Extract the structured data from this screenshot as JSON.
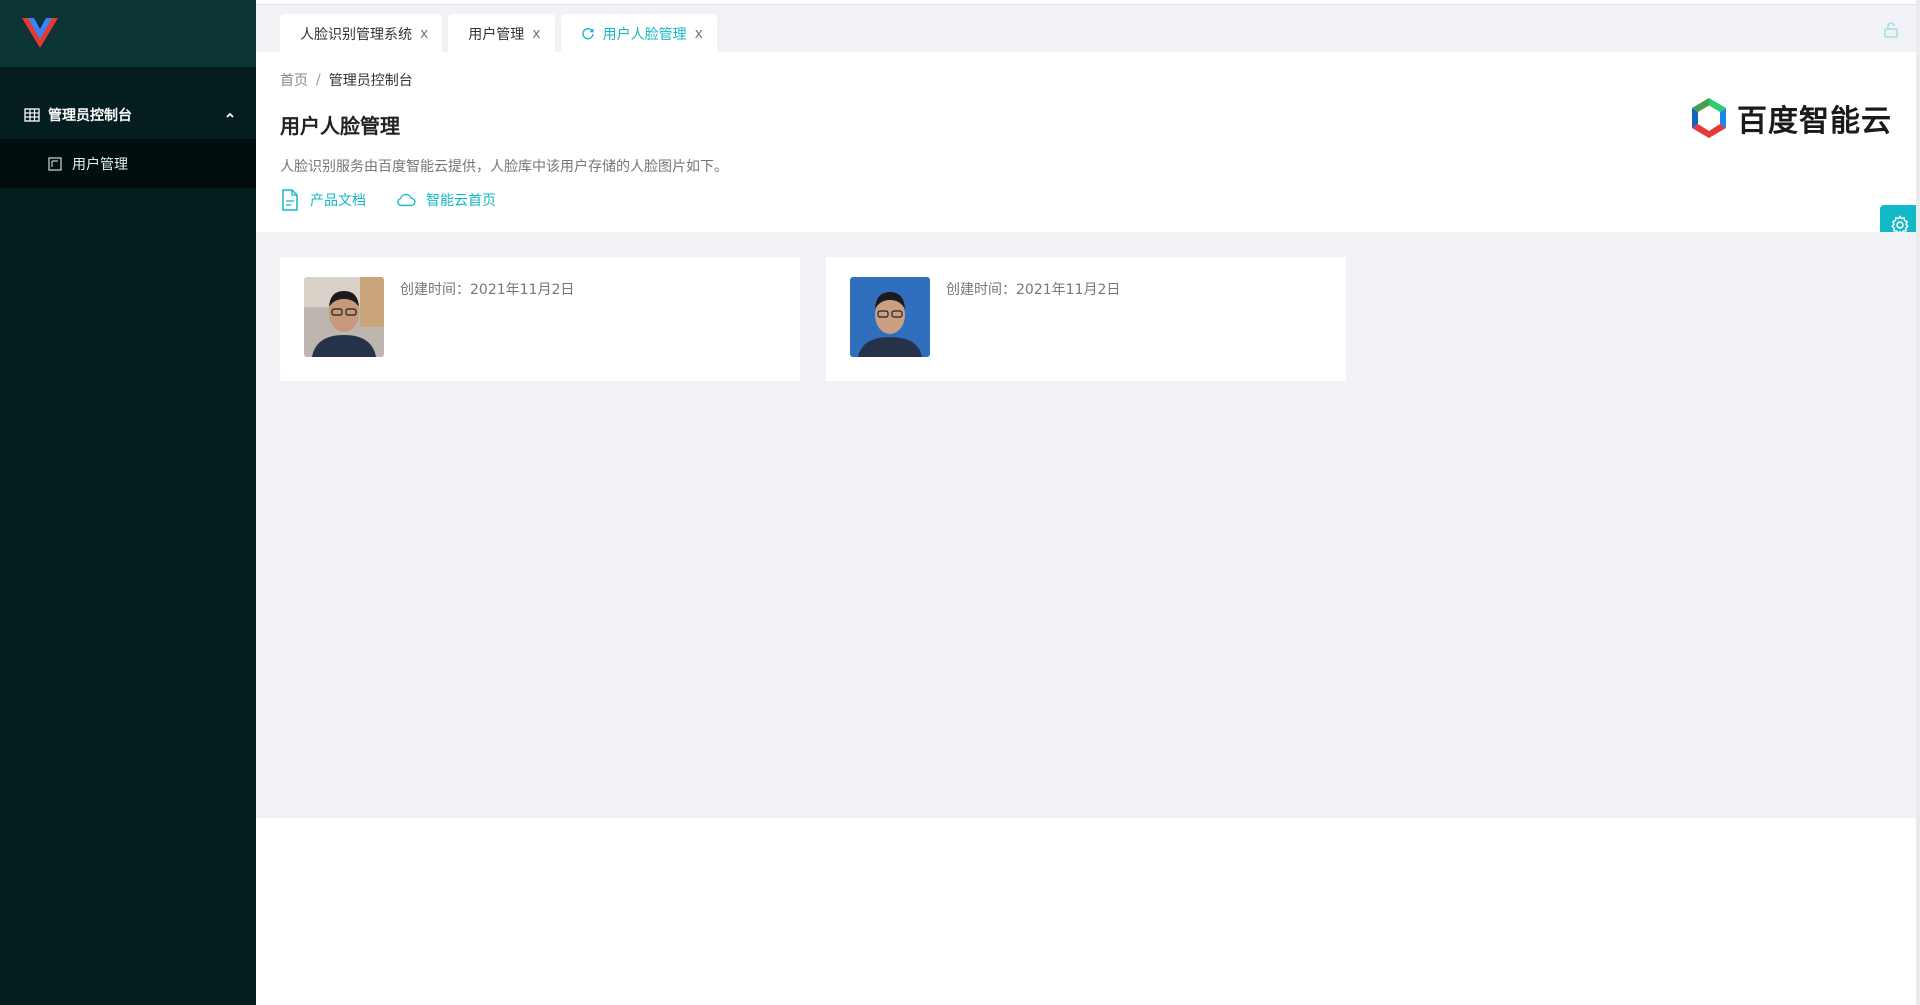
{
  "sidebar": {
    "menu_group_label": "管理员控制台",
    "items": [
      {
        "label": "用户管理"
      }
    ]
  },
  "tabs": [
    {
      "label": "人脸识别管理系统",
      "close": "x"
    },
    {
      "label": "用户管理",
      "close": "x"
    },
    {
      "label": "用户人脸管理",
      "close": "x",
      "active": true
    }
  ],
  "breadcrumb": {
    "home": "首页",
    "separator": "/",
    "current": "管理员控制台"
  },
  "page": {
    "title": "用户人脸管理",
    "description": "人脸识别服务由百度智能云提供，人脸库中该用户存储的人脸图片如下。",
    "links": [
      {
        "label": "产品文档",
        "icon": "document-icon"
      },
      {
        "label": "智能云首页",
        "icon": "cloud-icon"
      }
    ]
  },
  "brand": {
    "name": "百度智能云"
  },
  "faces": [
    {
      "created": "创建时间：2021年11月2日",
      "bg": "light"
    },
    {
      "created": "创建时间：2021年11月2日",
      "bg": "blue"
    }
  ],
  "colors": {
    "accent": "#13b8c6",
    "sidebar": "#041d1e",
    "sidebar_top": "#0a3534"
  }
}
